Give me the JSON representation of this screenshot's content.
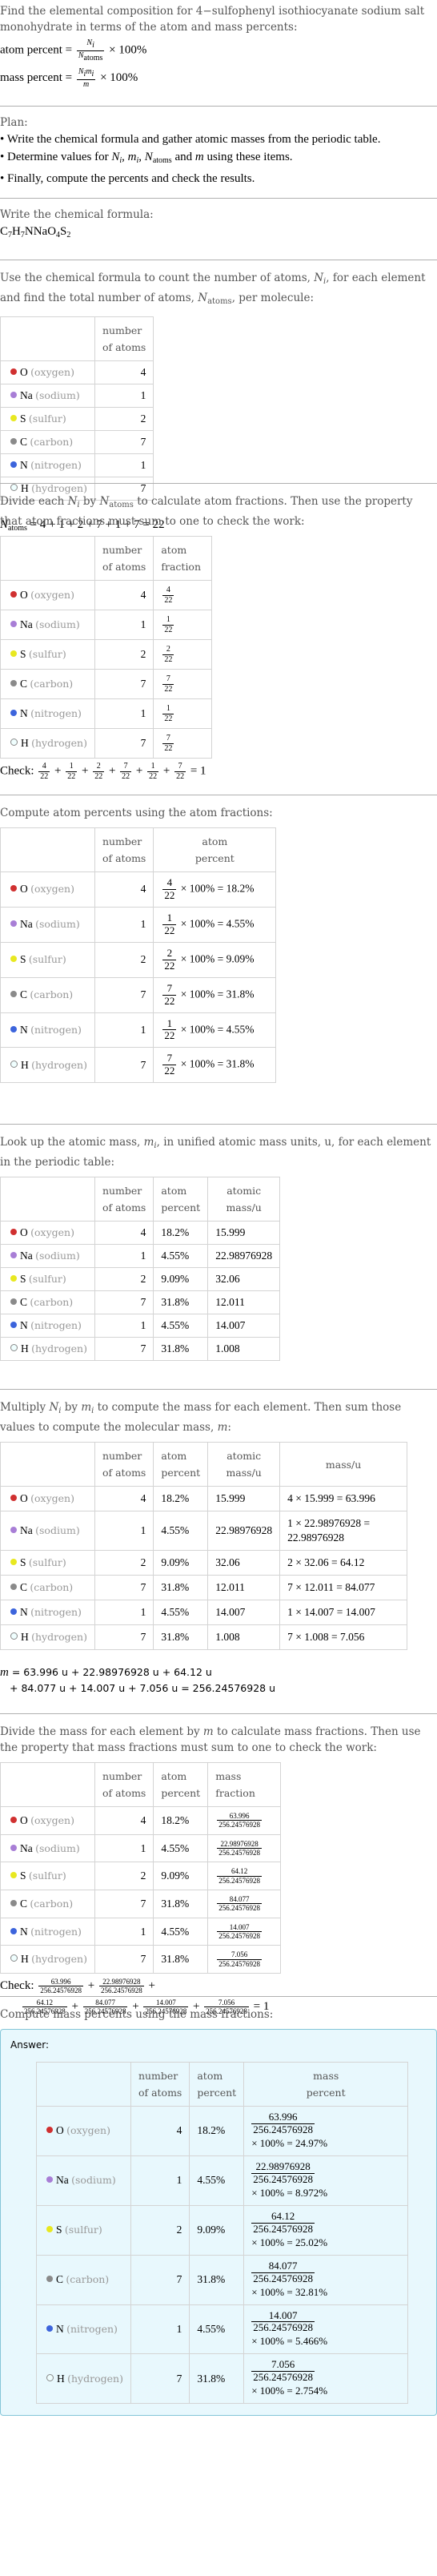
{
  "problem": {
    "intro": "Find the elemental composition for 4−sulfophenyl isothiocyanate sodium salt monohydrate in terms of the atom and mass percents:",
    "atom_percent_lhs": "atom percent =",
    "mass_percent_lhs": "mass percent =",
    "times_100": "× 100%"
  },
  "plan": {
    "title": "Plan:",
    "items": [
      "Write the chemical formula and gather atomic masses from the periodic table.",
      "Determine values for N_i, m_i, N_atoms and m using these items.",
      "Finally, compute the percents and check the results."
    ]
  },
  "formula": {
    "intro": "Write the chemical formula:",
    "parts": [
      {
        "el": "C",
        "n": "7"
      },
      {
        "el": "H",
        "n": "7"
      },
      {
        "el": "N",
        "n": ""
      },
      {
        "el": "Na",
        "n": ""
      },
      {
        "el": "O",
        "n": "4"
      },
      {
        "el": "S",
        "n": "2"
      }
    ]
  },
  "elements": [
    {
      "symbol": "O",
      "name": "(oxygen)",
      "color": "#d03030",
      "count": "4",
      "frac_num": "4",
      "atom_pct": "18.2%",
      "mass": "15.999",
      "mass_calc": "4 × 15.999 = 63.996",
      "mass_val": "63.996",
      "mass_pct": "24.97%"
    },
    {
      "symbol": "Na",
      "name": "(sodium)",
      "color": "#a87ed6",
      "count": "1",
      "frac_num": "1",
      "atom_pct": "4.55%",
      "mass": "22.98976928",
      "mass_calc": "1 × 22.98976928 = 22.98976928",
      "mass_val": "22.98976928",
      "mass_pct": "8.972%"
    },
    {
      "symbol": "S",
      "name": "(sulfur)",
      "color": "#e8e820",
      "count": "2",
      "frac_num": "2",
      "atom_pct": "9.09%",
      "mass": "32.06",
      "mass_calc": "2 × 32.06 = 64.12",
      "mass_val": "64.12",
      "mass_pct": "25.02%"
    },
    {
      "symbol": "C",
      "name": "(carbon)",
      "color": "#8a8a8a",
      "count": "7",
      "frac_num": "7",
      "atom_pct": "31.8%",
      "mass": "12.011",
      "mass_calc": "7 × 12.011 = 84.077",
      "mass_val": "84.077",
      "mass_pct": "32.81%"
    },
    {
      "symbol": "N",
      "name": "(nitrogen)",
      "color": "#3c64dc",
      "count": "1",
      "frac_num": "1",
      "atom_pct": "4.55%",
      "mass": "14.007",
      "mass_calc": "1 × 14.007 = 14.007",
      "mass_val": "14.007",
      "mass_pct": "5.466%"
    },
    {
      "symbol": "H",
      "name": "(hydrogen)",
      "color": "#f0ffff",
      "count": "7",
      "frac_num": "7",
      "atom_pct": "31.8%",
      "mass": "1.008",
      "mass_calc": "7 × 1.008 = 7.056",
      "mass_val": "7.056",
      "mass_pct": "2.754%"
    }
  ],
  "headers": {
    "number_of_atoms": [
      "number",
      "of atoms"
    ],
    "atom_fraction": [
      "atom",
      "fraction"
    ],
    "atom_percent": [
      "atom",
      "percent"
    ],
    "atomic_mass": [
      "atomic",
      "mass/u"
    ],
    "mass_u": "mass/u",
    "mass_fraction": [
      "mass",
      "fraction"
    ],
    "mass_percent": [
      "mass",
      "percent"
    ]
  },
  "count_section": {
    "intro": "Use the chemical formula to count the number of atoms, N_i, for each element and find the total number of atoms, N_atoms, per molecule:",
    "sum": "= 4 + 1 + 2 + 7 + 1 + 7 = 22"
  },
  "fraction_section": {
    "intro": "Divide each N_i by N_atoms to calculate atom fractions. Then use the property that atom fractions must sum to one to check the work:",
    "denominator": "22",
    "check_label": "Check:",
    "check_result": "= 1"
  },
  "atom_percent_section": {
    "intro": "Compute atom percents using the atom fractions:"
  },
  "atomic_mass_section": {
    "intro": "Look up the atomic mass, m_i, in unified atomic mass units, u, for each element in the periodic table:"
  },
  "molecular_mass_section": {
    "intro": "Multiply N_i by m_i to compute the mass for each element. Then sum those values to compute the molecular mass, m:",
    "line1": "= 63.996 u + 22.98976928 u + 64.12 u",
    "line2": "+ 84.077 u + 14.007 u + 7.056 u = 256.24576928 u",
    "total": "256.24576928"
  },
  "mass_fraction_section": {
    "intro": "Divide the mass for each element by m to calculate mass fractions. Then use the property that mass fractions must sum to one to check the work:",
    "check_label": "Check:",
    "check_result": "= 1"
  },
  "mass_percent_section": {
    "intro": "Compute mass percents using the mass fractions:",
    "answer_label": "Answer:"
  }
}
